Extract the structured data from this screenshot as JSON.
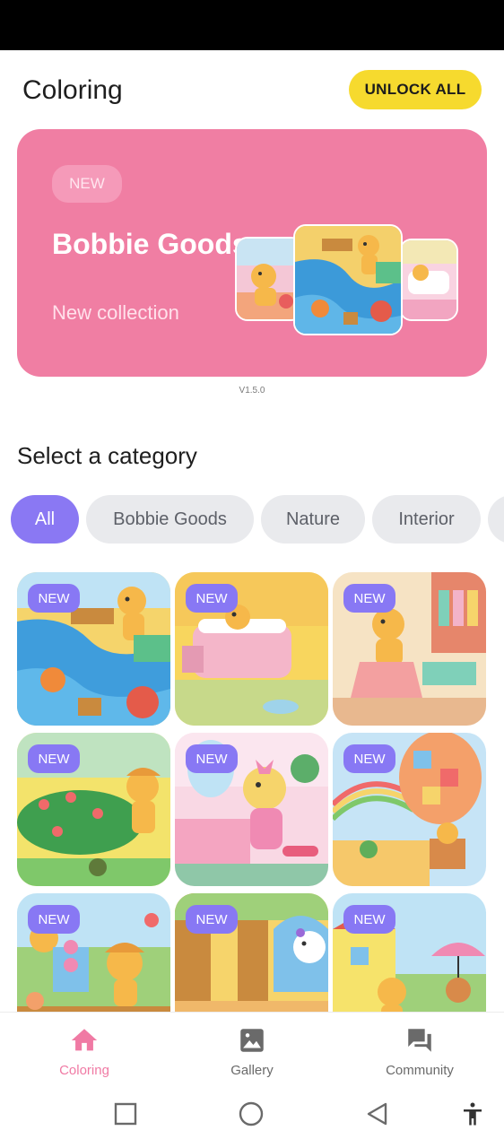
{
  "header": {
    "title": "Coloring",
    "unlock_label": "UNLOCK ALL"
  },
  "banner": {
    "badge": "NEW",
    "title": "Bobbie Goods",
    "subtitle": "New collection"
  },
  "version": "V1.5.0",
  "categories": {
    "title": "Select a category",
    "chips": [
      {
        "label": "All",
        "selected": true
      },
      {
        "label": "Bobbie Goods",
        "selected": false
      },
      {
        "label": "Nature",
        "selected": false
      },
      {
        "label": "Interior",
        "selected": false
      }
    ]
  },
  "grid": {
    "badge_label": "NEW",
    "items": [
      {
        "badge": "NEW"
      },
      {
        "badge": "NEW"
      },
      {
        "badge": "NEW"
      },
      {
        "badge": "NEW"
      },
      {
        "badge": "NEW"
      },
      {
        "badge": "NEW"
      },
      {
        "badge": "NEW"
      },
      {
        "badge": "NEW"
      },
      {
        "badge": "NEW"
      }
    ]
  },
  "nav": {
    "items": [
      {
        "label": "Coloring",
        "icon": "home-icon",
        "active": true
      },
      {
        "label": "Gallery",
        "icon": "image-icon",
        "active": false
      },
      {
        "label": "Community",
        "icon": "forum-icon",
        "active": false
      }
    ]
  },
  "colors": {
    "accent": "#8a78f3",
    "banner": "#f07ea3",
    "unlock": "#f6da2e",
    "nav_active": "#f07aa4"
  }
}
